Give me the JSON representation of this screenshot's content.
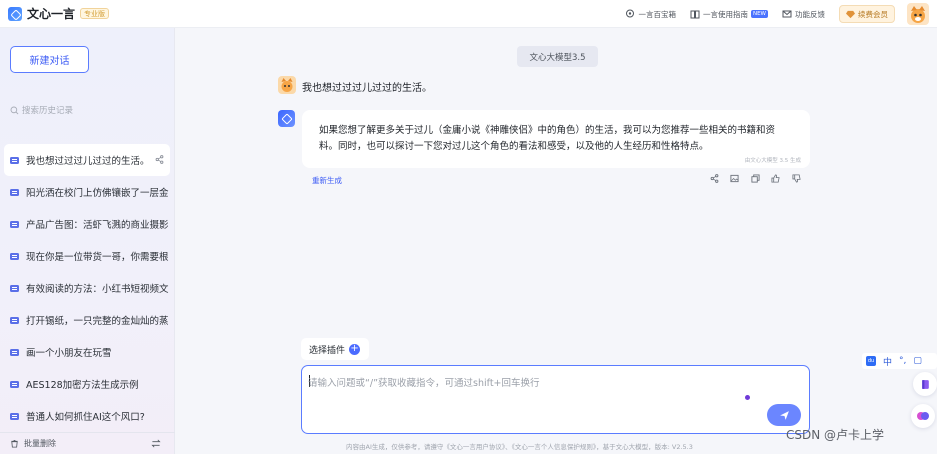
{
  "header": {
    "brand": "文心一言",
    "pro_badge": "专业版",
    "links": [
      {
        "label": "一言百宝箱"
      },
      {
        "label": "一言使用指南",
        "badge": "NEW"
      },
      {
        "label": "功能反馈"
      }
    ],
    "vip_label": "续费会员"
  },
  "sidebar": {
    "new_chat": "新建对话",
    "search_placeholder": "搜索历史记录",
    "items": [
      {
        "label": "我也想过过过儿过过的生活。"
      },
      {
        "label": "阳光洒在校门上仿佛镶嵌了一层金"
      },
      {
        "label": "产品广告图：活虾飞溅的商业摄影"
      },
      {
        "label": "现在你是一位带货一哥，你需要根"
      },
      {
        "label": "有效阅读的方法：小红书短视频文"
      },
      {
        "label": "打开锡纸，一只完整的金灿灿的蒸"
      },
      {
        "label": "画一个小朋友在玩雪"
      },
      {
        "label": "AES128加密方法生成示例"
      },
      {
        "label": "普通人如何抓住AI这个风口?"
      }
    ],
    "bulk_delete": "批量删除"
  },
  "chat": {
    "model_tag": "文心大模型3.5",
    "user_message": "我也想过过过儿过过的生活。",
    "bot_message": "如果您想了解更多关于过儿（金庸小说《神雕侠侣》中的角色）的生活，我可以为您推荐一些相关的书籍和资料。同时，也可以探讨一下您对过儿这个角色的看法和感受，以及他的人生经历和性格特点。",
    "bot_note": "由文心大模型 3.5 生成",
    "regenerate": "重新生成"
  },
  "composer": {
    "plugin_label": "选择插件",
    "placeholder": "请输入问题或“/”获取收藏指令，可通过shift+回车换行",
    "footer": "内容由AI生成，仅供参考，请遵守《文心一言用户协议》、《文心一言个人信息保护规则》，基于文心大模型，版本: V2.5.3"
  },
  "ime": {
    "logo": "du",
    "mode": "中"
  },
  "watermark": "CSDN @卢卡上学",
  "colors": {
    "accent": "#4b6bff",
    "background": "#f5f6fa"
  }
}
